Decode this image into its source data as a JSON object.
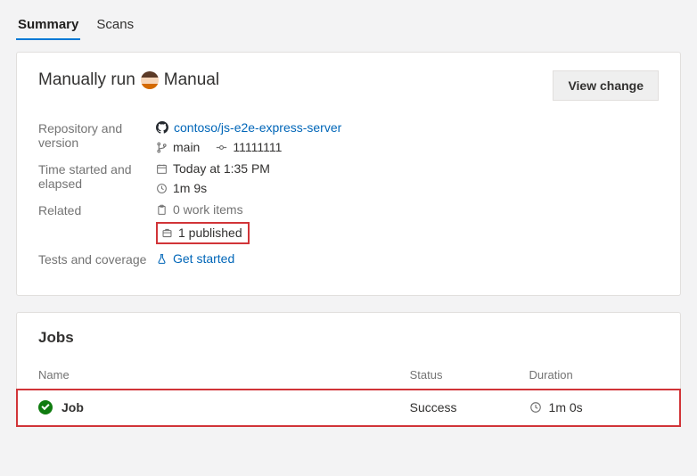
{
  "tabs": {
    "summary": "Summary",
    "scans": "Scans"
  },
  "run": {
    "prefix": "Manually run",
    "name": "Manual",
    "view_change": "View change",
    "labels": {
      "repo_version": "Repository and version",
      "time": "Time started and elapsed",
      "related": "Related",
      "tests": "Tests and coverage"
    },
    "repo": "contoso/js-e2e-express-server",
    "branch": "main",
    "commit": "11111111",
    "started": "Today at 1:35 PM",
    "elapsed": "1m 9s",
    "work_items": "0 work items",
    "published": "1 published",
    "get_started": "Get started"
  },
  "jobs": {
    "title": "Jobs",
    "columns": {
      "name": "Name",
      "status": "Status",
      "duration": "Duration"
    },
    "items": [
      {
        "name": "Job",
        "status": "Success",
        "duration": "1m 0s"
      }
    ]
  }
}
